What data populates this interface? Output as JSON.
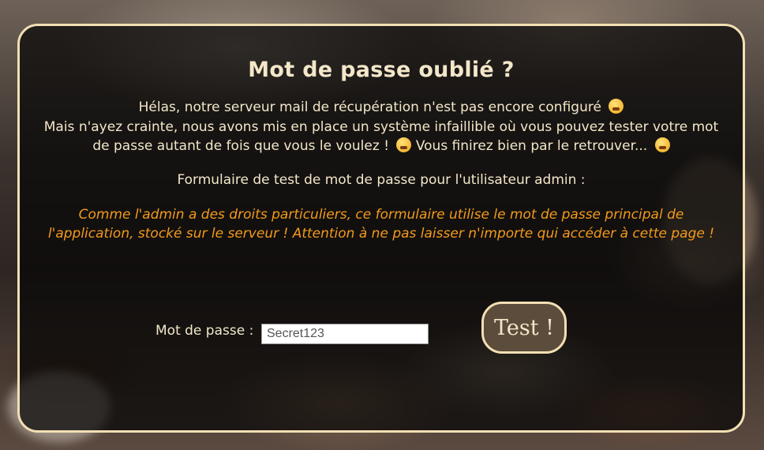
{
  "page": {
    "title": "Mot de passe oublié ?",
    "intro_line1": "Hélas, notre serveur mail de récupération n'est pas encore configuré",
    "intro_line2": "Mais n'ayez crainte, nous avons mis en place un système infaillible où vous pouvez tester votre mot de passe autant de fois que vous le voulez !",
    "intro_line3": "Vous finirez bien par le retrouver...",
    "user_line": "Formulaire de test de mot de passe pour l'utilisateur admin :",
    "warning": "Comme l'admin a des droits particuliers, ce formulaire utilise le mot de passe principal de l'application, stocké sur le serveur ! Attention à ne pas laisser n'importe qui accéder à cette page !"
  },
  "form": {
    "password_label": "Mot de passe :",
    "password_value": "Secret123",
    "submit_label": "Test !"
  },
  "colors": {
    "panel_border": "#f3dfb4",
    "text": "#f3e7c9",
    "warning": "#f39a1d"
  },
  "icons": {
    "emoji_1": "grimacing-face-icon",
    "emoji_2": "flushed-face-icon",
    "emoji_3": "winking-tongue-face-icon"
  }
}
